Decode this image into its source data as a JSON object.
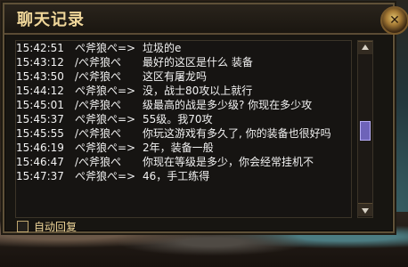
{
  "dialog": {
    "title": "聊天记录",
    "close_icon_glyph": "✕",
    "auto_reply_label": "自动回复"
  },
  "messages": [
    {
      "time": "15:42:51",
      "user": "ぺ斧狼ぺ=>",
      "text": "垃圾的e"
    },
    {
      "time": "15:43:12",
      "user": "/ぺ斧狼ぺ",
      "text": "最好的这区是什么 装备"
    },
    {
      "time": "15:43:50",
      "user": "/ぺ斧狼ぺ",
      "text": "这区有屠龙吗"
    },
    {
      "time": "15:44:12",
      "user": "ぺ斧狼ぺ=>",
      "text": "没，战士80攻以上就行"
    },
    {
      "time": "15:45:01",
      "user": "/ぺ斧狼ぺ",
      "text": "级最高的战是多少级? 你现在多少攻"
    },
    {
      "time": "15:45:37",
      "user": "ぺ斧狼ぺ=>",
      "text": "55级。我70攻"
    },
    {
      "time": "15:45:55",
      "user": "/ぺ斧狼ぺ",
      "text": "你玩这游戏有多久了, 你的装备也很好吗"
    },
    {
      "time": "15:46:19",
      "user": "ぺ斧狼ぺ=>",
      "text": "2年，装备一般"
    },
    {
      "time": "15:46:47",
      "user": "/ぺ斧狼ぺ",
      "text": "你现在等级是多少，你会经常挂机不"
    },
    {
      "time": "15:47:37",
      "user": "ぺ斧狼ぺ=>",
      "text": "46，手工练得"
    }
  ]
}
